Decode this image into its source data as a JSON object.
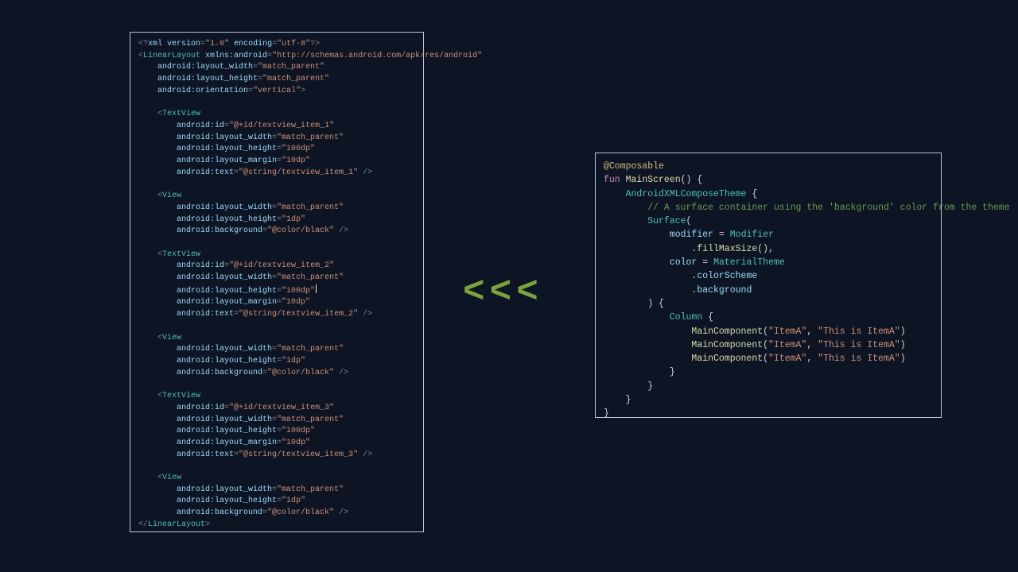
{
  "arrows": "<<<",
  "left_code": {
    "lines": [
      [
        {
          "t": "<?",
          "c": "c-punc"
        },
        {
          "t": "xml version",
          "c": "c-attr"
        },
        {
          "t": "=",
          "c": "c-punc"
        },
        {
          "t": "\"1.0\"",
          "c": "c-str"
        },
        {
          "t": " encoding",
          "c": "c-attr"
        },
        {
          "t": "=",
          "c": "c-punc"
        },
        {
          "t": "\"utf-8\"",
          "c": "c-str"
        },
        {
          "t": "?>",
          "c": "c-punc"
        }
      ],
      [
        {
          "t": "<",
          "c": "c-punc"
        },
        {
          "t": "LinearLayout",
          "c": "c-tag"
        },
        {
          "t": " xmlns:android",
          "c": "c-attr"
        },
        {
          "t": "=",
          "c": "c-punc"
        },
        {
          "t": "\"http://schemas.android.com/apk/res/android\"",
          "c": "c-str"
        }
      ],
      [
        {
          "t": "    android:layout_width",
          "c": "c-attr"
        },
        {
          "t": "=",
          "c": "c-punc"
        },
        {
          "t": "\"match_parent\"",
          "c": "c-str"
        }
      ],
      [
        {
          "t": "    android:layout_height",
          "c": "c-attr"
        },
        {
          "t": "=",
          "c": "c-punc"
        },
        {
          "t": "\"match_parent\"",
          "c": "c-str"
        }
      ],
      [
        {
          "t": "    android:orientation",
          "c": "c-attr"
        },
        {
          "t": "=",
          "c": "c-punc"
        },
        {
          "t": "\"vertical\"",
          "c": "c-str"
        },
        {
          "t": ">",
          "c": "c-punc"
        }
      ],
      [
        {
          "t": " ",
          "c": ""
        }
      ],
      [
        {
          "t": "    <",
          "c": "c-punc"
        },
        {
          "t": "TextView",
          "c": "c-tag"
        }
      ],
      [
        {
          "t": "        android:id",
          "c": "c-attr"
        },
        {
          "t": "=",
          "c": "c-punc"
        },
        {
          "t": "\"@+id/textview_item_1\"",
          "c": "c-str"
        }
      ],
      [
        {
          "t": "        android:layout_width",
          "c": "c-attr"
        },
        {
          "t": "=",
          "c": "c-punc"
        },
        {
          "t": "\"match_parent\"",
          "c": "c-str"
        }
      ],
      [
        {
          "t": "        android:layout_height",
          "c": "c-attr"
        },
        {
          "t": "=",
          "c": "c-punc"
        },
        {
          "t": "\"100dp\"",
          "c": "c-str"
        }
      ],
      [
        {
          "t": "        android:layout_margin",
          "c": "c-attr"
        },
        {
          "t": "=",
          "c": "c-punc"
        },
        {
          "t": "\"10dp\"",
          "c": "c-str"
        }
      ],
      [
        {
          "t": "        android:text",
          "c": "c-attr"
        },
        {
          "t": "=",
          "c": "c-punc"
        },
        {
          "t": "\"@string/textview_item_1\"",
          "c": "c-str"
        },
        {
          "t": " />",
          "c": "c-punc"
        }
      ],
      [
        {
          "t": " ",
          "c": ""
        }
      ],
      [
        {
          "t": "    <",
          "c": "c-punc"
        },
        {
          "t": "View",
          "c": "c-tag"
        }
      ],
      [
        {
          "t": "        android:layout_width",
          "c": "c-attr"
        },
        {
          "t": "=",
          "c": "c-punc"
        },
        {
          "t": "\"match_parent\"",
          "c": "c-str"
        }
      ],
      [
        {
          "t": "        android:layout_height",
          "c": "c-attr"
        },
        {
          "t": "=",
          "c": "c-punc"
        },
        {
          "t": "\"1dp\"",
          "c": "c-str"
        }
      ],
      [
        {
          "t": "        android:background",
          "c": "c-attr"
        },
        {
          "t": "=",
          "c": "c-punc"
        },
        {
          "t": "\"@color/black\"",
          "c": "c-str"
        },
        {
          "t": " />",
          "c": "c-punc"
        }
      ],
      [
        {
          "t": " ",
          "c": ""
        }
      ],
      [
        {
          "t": "    <",
          "c": "c-punc"
        },
        {
          "t": "TextView",
          "c": "c-tag"
        }
      ],
      [
        {
          "t": "        android:id",
          "c": "c-attr"
        },
        {
          "t": "=",
          "c": "c-punc"
        },
        {
          "t": "\"@+id/textview_item_2\"",
          "c": "c-str"
        }
      ],
      [
        {
          "t": "        android:layout_width",
          "c": "c-attr"
        },
        {
          "t": "=",
          "c": "c-punc"
        },
        {
          "t": "\"match_parent\"",
          "c": "c-str"
        }
      ],
      [
        {
          "t": "        android:layout_height",
          "c": "c-attr"
        },
        {
          "t": "=",
          "c": "c-punc"
        },
        {
          "t": "\"100dp\"",
          "c": "c-str"
        },
        {
          "t": "|",
          "c": "cursor-mark"
        }
      ],
      [
        {
          "t": "        android:layout_margin",
          "c": "c-attr"
        },
        {
          "t": "=",
          "c": "c-punc"
        },
        {
          "t": "\"10dp\"",
          "c": "c-str"
        }
      ],
      [
        {
          "t": "        android:text",
          "c": "c-attr"
        },
        {
          "t": "=",
          "c": "c-punc"
        },
        {
          "t": "\"@string/textview_item_2\"",
          "c": "c-str"
        },
        {
          "t": " />",
          "c": "c-punc"
        }
      ],
      [
        {
          "t": " ",
          "c": ""
        }
      ],
      [
        {
          "t": "    <",
          "c": "c-punc"
        },
        {
          "t": "View",
          "c": "c-tag"
        }
      ],
      [
        {
          "t": "        android:layout_width",
          "c": "c-attr"
        },
        {
          "t": "=",
          "c": "c-punc"
        },
        {
          "t": "\"match_parent\"",
          "c": "c-str"
        }
      ],
      [
        {
          "t": "        android:layout_height",
          "c": "c-attr"
        },
        {
          "t": "=",
          "c": "c-punc"
        },
        {
          "t": "\"1dp\"",
          "c": "c-str"
        }
      ],
      [
        {
          "t": "        android:background",
          "c": "c-attr"
        },
        {
          "t": "=",
          "c": "c-punc"
        },
        {
          "t": "\"@color/black\"",
          "c": "c-str"
        },
        {
          "t": " />",
          "c": "c-punc"
        }
      ],
      [
        {
          "t": " ",
          "c": ""
        }
      ],
      [
        {
          "t": "    <",
          "c": "c-punc"
        },
        {
          "t": "TextView",
          "c": "c-tag"
        }
      ],
      [
        {
          "t": "        android:id",
          "c": "c-attr"
        },
        {
          "t": "=",
          "c": "c-punc"
        },
        {
          "t": "\"@+id/textview_item_3\"",
          "c": "c-str"
        }
      ],
      [
        {
          "t": "        android:layout_width",
          "c": "c-attr"
        },
        {
          "t": "=",
          "c": "c-punc"
        },
        {
          "t": "\"match_parent\"",
          "c": "c-str"
        }
      ],
      [
        {
          "t": "        android:layout_height",
          "c": "c-attr"
        },
        {
          "t": "=",
          "c": "c-punc"
        },
        {
          "t": "\"100dp\"",
          "c": "c-str"
        }
      ],
      [
        {
          "t": "        android:layout_margin",
          "c": "c-attr"
        },
        {
          "t": "=",
          "c": "c-punc"
        },
        {
          "t": "\"10dp\"",
          "c": "c-str"
        }
      ],
      [
        {
          "t": "        android:text",
          "c": "c-attr"
        },
        {
          "t": "=",
          "c": "c-punc"
        },
        {
          "t": "\"@string/textview_item_3\"",
          "c": "c-str"
        },
        {
          "t": " />",
          "c": "c-punc"
        }
      ],
      [
        {
          "t": " ",
          "c": ""
        }
      ],
      [
        {
          "t": "    <",
          "c": "c-punc"
        },
        {
          "t": "View",
          "c": "c-tag"
        }
      ],
      [
        {
          "t": "        android:layout_width",
          "c": "c-attr"
        },
        {
          "t": "=",
          "c": "c-punc"
        },
        {
          "t": "\"match_parent\"",
          "c": "c-str"
        }
      ],
      [
        {
          "t": "        android:layout_height",
          "c": "c-attr"
        },
        {
          "t": "=",
          "c": "c-punc"
        },
        {
          "t": "\"1dp\"",
          "c": "c-str"
        }
      ],
      [
        {
          "t": "        android:background",
          "c": "c-attr"
        },
        {
          "t": "=",
          "c": "c-punc"
        },
        {
          "t": "\"@color/black\"",
          "c": "c-str"
        },
        {
          "t": " />",
          "c": "c-punc"
        }
      ],
      [
        {
          "t": "</",
          "c": "c-punc"
        },
        {
          "t": "LinearLayout",
          "c": "c-tag"
        },
        {
          "t": ">",
          "c": "c-punc"
        }
      ]
    ]
  },
  "right_code": {
    "lines": [
      [
        {
          "t": "@Composable",
          "c": "c-annot"
        }
      ],
      [
        {
          "t": "fun",
          "c": "c-key"
        },
        {
          "t": " ",
          "c": ""
        },
        {
          "t": "MainScreen",
          "c": "c-func"
        },
        {
          "t": "() {",
          "c": "c-op"
        }
      ],
      [
        {
          "t": "    ",
          "c": ""
        },
        {
          "t": "AndroidXMLComposeTheme",
          "c": "c-tag"
        },
        {
          "t": " {",
          "c": "c-op"
        }
      ],
      [
        {
          "t": "        ",
          "c": ""
        },
        {
          "t": "// A surface container using the 'background' color from the theme",
          "c": "c-comm"
        }
      ],
      [
        {
          "t": "        ",
          "c": ""
        },
        {
          "t": "Surface",
          "c": "c-tag"
        },
        {
          "t": "(",
          "c": "c-op"
        }
      ],
      [
        {
          "t": "            ",
          "c": ""
        },
        {
          "t": "modifier",
          "c": "c-attr"
        },
        {
          "t": " = ",
          "c": "c-op"
        },
        {
          "t": "Modifier",
          "c": "c-tag"
        }
      ],
      [
        {
          "t": "                .",
          "c": "c-op"
        },
        {
          "t": "fillMaxSize",
          "c": "c-func"
        },
        {
          "t": "(),",
          "c": "c-op"
        }
      ],
      [
        {
          "t": "            ",
          "c": ""
        },
        {
          "t": "color",
          "c": "c-attr"
        },
        {
          "t": " = ",
          "c": "c-op"
        },
        {
          "t": "MaterialTheme",
          "c": "c-tag"
        }
      ],
      [
        {
          "t": "                .",
          "c": "c-op"
        },
        {
          "t": "colorScheme",
          "c": "c-attr"
        }
      ],
      [
        {
          "t": "                .",
          "c": "c-op"
        },
        {
          "t": "background",
          "c": "c-attr"
        }
      ],
      [
        {
          "t": "        ) {",
          "c": "c-op"
        }
      ],
      [
        {
          "t": "            ",
          "c": ""
        },
        {
          "t": "Column",
          "c": "c-tag"
        },
        {
          "t": " {",
          "c": "c-op"
        }
      ],
      [
        {
          "t": "                ",
          "c": ""
        },
        {
          "t": "MainComponent",
          "c": "c-func"
        },
        {
          "t": "(",
          "c": "c-op"
        },
        {
          "t": "\"ItemA\"",
          "c": "c-str"
        },
        {
          "t": ", ",
          "c": "c-op"
        },
        {
          "t": "\"This is ItemA\"",
          "c": "c-str"
        },
        {
          "t": ")",
          "c": "c-op"
        }
      ],
      [
        {
          "t": "                ",
          "c": ""
        },
        {
          "t": "MainComponent",
          "c": "c-func"
        },
        {
          "t": "(",
          "c": "c-op"
        },
        {
          "t": "\"ItemA\"",
          "c": "c-str"
        },
        {
          "t": ", ",
          "c": "c-op"
        },
        {
          "t": "\"This is ItemA\"",
          "c": "c-str"
        },
        {
          "t": ")",
          "c": "c-op"
        }
      ],
      [
        {
          "t": "                ",
          "c": ""
        },
        {
          "t": "MainComponent",
          "c": "c-func"
        },
        {
          "t": "(",
          "c": "c-op"
        },
        {
          "t": "\"ItemA\"",
          "c": "c-str"
        },
        {
          "t": ", ",
          "c": "c-op"
        },
        {
          "t": "\"This is ItemA\"",
          "c": "c-str"
        },
        {
          "t": ")",
          "c": "c-op"
        }
      ],
      [
        {
          "t": "            }",
          "c": "c-op"
        }
      ],
      [
        {
          "t": "        }",
          "c": "c-op"
        }
      ],
      [
        {
          "t": "    }",
          "c": "c-op"
        }
      ],
      [
        {
          "t": "}",
          "c": "c-op"
        }
      ]
    ]
  }
}
